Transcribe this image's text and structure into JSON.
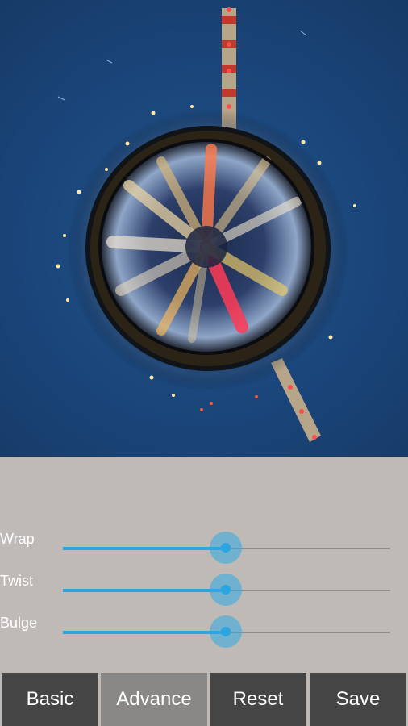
{
  "photo": {
    "description_icon": "tiny-planet-photo"
  },
  "sliders": [
    {
      "label": "Wrap",
      "value_percent": 50
    },
    {
      "label": "Twist",
      "value_percent": 50
    },
    {
      "label": "Bulge",
      "value_percent": 50
    }
  ],
  "buttons": [
    {
      "label": "Basic",
      "active": false
    },
    {
      "label": "Advance",
      "active": true
    },
    {
      "label": "Reset",
      "active": false
    },
    {
      "label": "Save",
      "active": false
    }
  ],
  "colors": {
    "panel_bg": "#bfbab6",
    "button_bg": "#454545",
    "button_active_bg": "#8a8886",
    "slider_accent": "#2aa5e0"
  }
}
